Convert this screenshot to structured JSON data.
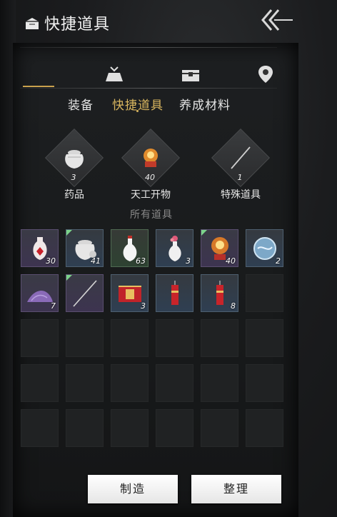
{
  "header": {
    "title": "快捷道具",
    "title_icon": "pack-icon",
    "back_icon": "back-arrow-icon"
  },
  "category_icons": [
    {
      "name": "crossed-swords-icon",
      "active": true
    },
    {
      "name": "pouch-icon",
      "active": false
    },
    {
      "name": "chest-icon",
      "active": false
    },
    {
      "name": "map-pin-icon",
      "active": false
    }
  ],
  "tabs": [
    {
      "label": "装备",
      "active": false
    },
    {
      "label": "快捷道具",
      "active": true
    },
    {
      "label": "养成材料",
      "active": false
    }
  ],
  "equipped": [
    {
      "label": "药品",
      "count": "3",
      "icon": "jar-icon"
    },
    {
      "label": "天工开物",
      "count": "40",
      "icon": "firework-icon"
    },
    {
      "label": "特殊道具",
      "count": "1",
      "icon": "needle-icon"
    }
  ],
  "all_items_label": "所有道具",
  "items": [
    {
      "icon": "red-vase-icon",
      "count": "30",
      "bg": "purple",
      "new": false
    },
    {
      "icon": "jar-icon",
      "count": "41",
      "bg": "blue",
      "new": true
    },
    {
      "icon": "white-vase-icon",
      "count": "63",
      "bg": "green",
      "new": false
    },
    {
      "icon": "flower-vase-icon",
      "count": "3",
      "bg": "blue",
      "new": false
    },
    {
      "icon": "firework-icon",
      "count": "40",
      "bg": "purple",
      "new": true
    },
    {
      "icon": "blue-orb-icon",
      "count": "2",
      "bg": "blue",
      "new": false
    },
    {
      "icon": "purple-powder-icon",
      "count": "7",
      "bg": "purple",
      "new": false
    },
    {
      "icon": "needle-icon",
      "count": "",
      "bg": "purple",
      "new": true
    },
    {
      "icon": "red-box-icon",
      "count": "3",
      "bg": "blue",
      "new": false
    },
    {
      "icon": "firecracker-icon",
      "count": "",
      "bg": "blue",
      "new": false
    },
    {
      "icon": "firecracker-icon",
      "count": "8",
      "bg": "blue",
      "new": false
    }
  ],
  "buttons": {
    "craft": "制造",
    "sort": "整理"
  },
  "colors": {
    "accent": "#c9a14d",
    "new_marker": "#7bd38a"
  }
}
